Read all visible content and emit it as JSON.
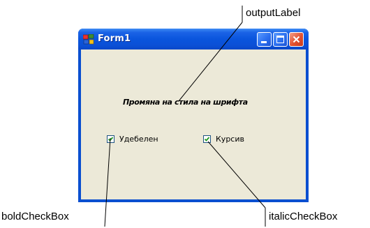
{
  "window": {
    "title": "Form1",
    "output_label": "Промяна на стила на шрифта",
    "bold_checkbox": {
      "label": "Удебелен",
      "checked": true
    },
    "italic_checkbox": {
      "label": "Курсив",
      "checked": true
    }
  },
  "callouts": {
    "output": "outputLabel",
    "bold": "boldCheckBox",
    "italic": "italicCheckBox"
  },
  "icons": {
    "app": "form-app-icon",
    "minimize": "minimize-icon",
    "maximize": "maximize-icon",
    "close": "close-icon",
    "checkmark": "checkmark-icon"
  },
  "colors": {
    "titlebar": "#0a55dd",
    "client_background": "#ece9d8",
    "close_button": "#e2502f",
    "checkbox_border": "#1c5180"
  }
}
